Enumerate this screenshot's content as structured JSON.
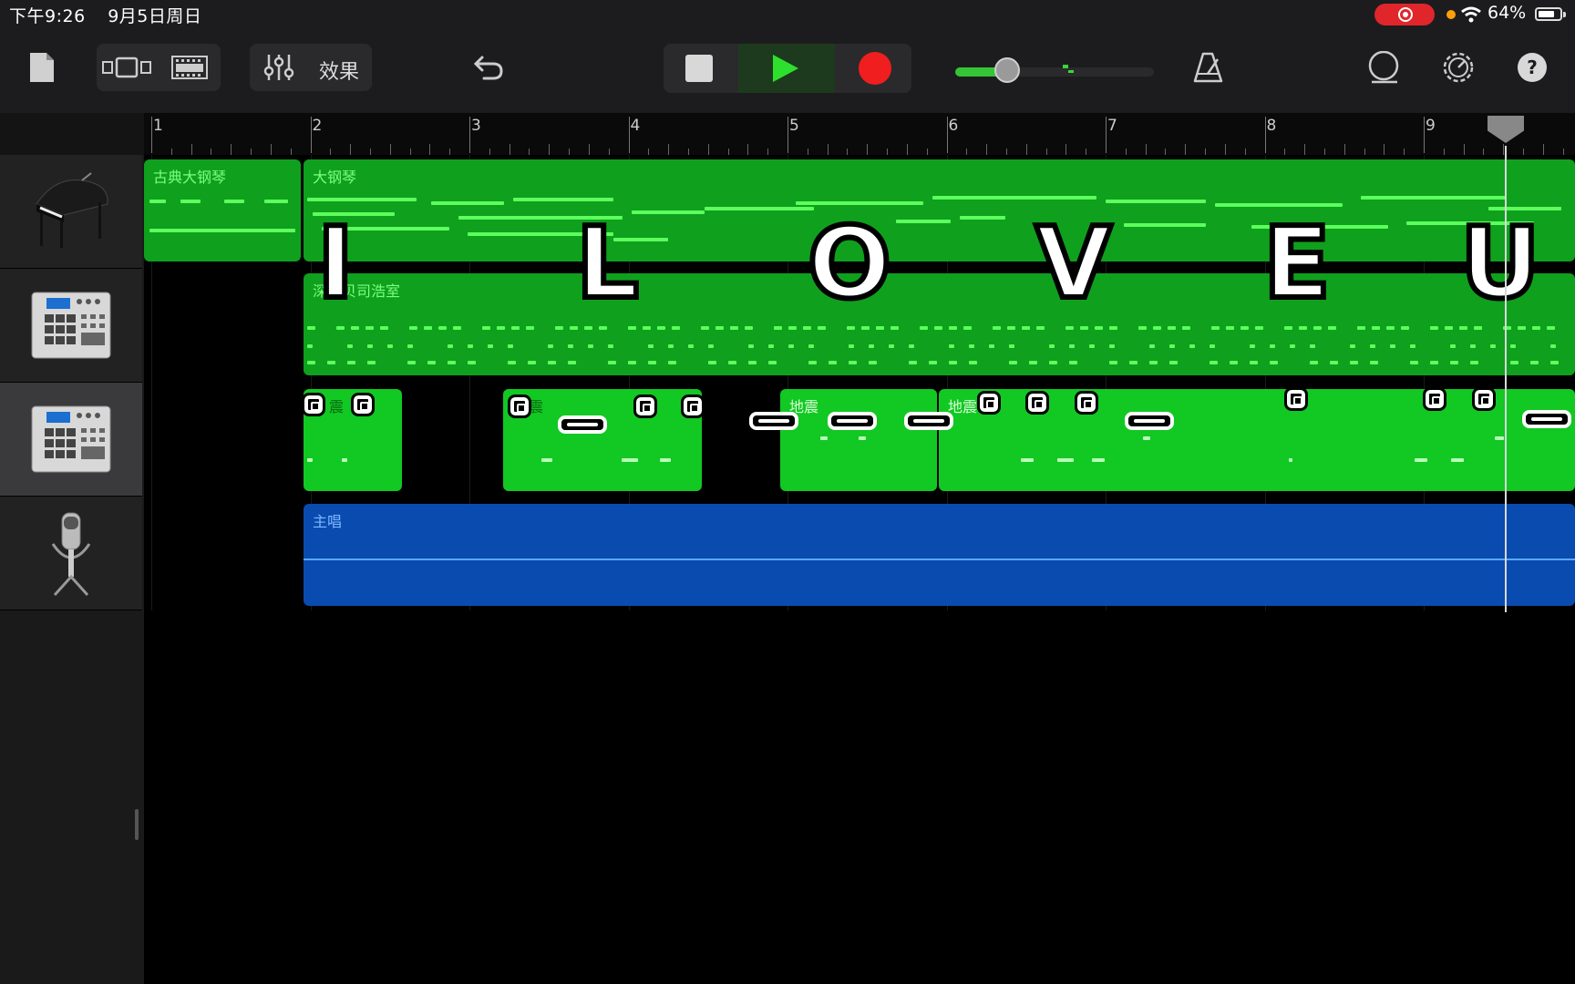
{
  "status_bar": {
    "time": "下午9:26",
    "date": "9月5日周日",
    "battery": "64%"
  },
  "toolbar": {
    "effects_label": "效果",
    "icons": [
      "document-icon",
      "browser-view-icon",
      "tracks-view-icon",
      "mixer-icon",
      "undo-icon",
      "stop-icon",
      "play-icon",
      "record-icon",
      "metronome-icon",
      "loop-icon",
      "settings-icon",
      "help-icon"
    ],
    "volume_level": 0.25
  },
  "ruler": {
    "bars": [
      "1",
      "2",
      "3",
      "4",
      "5",
      "6",
      "7",
      "8",
      "9"
    ]
  },
  "tracks": [
    {
      "instrument": "grand-piano-icon",
      "regions": [
        {
          "name": "古典大钢琴"
        },
        {
          "name": "大钢琴"
        }
      ]
    },
    {
      "instrument": "drum-machine-icon",
      "regions": [
        {
          "name": "深圳贝司浩室"
        }
      ]
    },
    {
      "instrument": "drum-machine-icon",
      "selected": true,
      "regions": [
        {
          "name": "震"
        },
        {
          "name": "震"
        },
        {
          "name": "地震"
        },
        {
          "name": "地震"
        }
      ]
    },
    {
      "instrument": "microphone-icon",
      "regions": [
        {
          "name": "主唱"
        }
      ]
    }
  ],
  "overlay_text": [
    "I",
    "L",
    "O",
    "V",
    "E",
    "U"
  ],
  "colors": {
    "region_green": "#0fa01e",
    "region_bright_green": "#12c823",
    "region_blue": "#0a4bb0",
    "record_red": "#f01e1e",
    "play_green": "#2ee02e"
  }
}
